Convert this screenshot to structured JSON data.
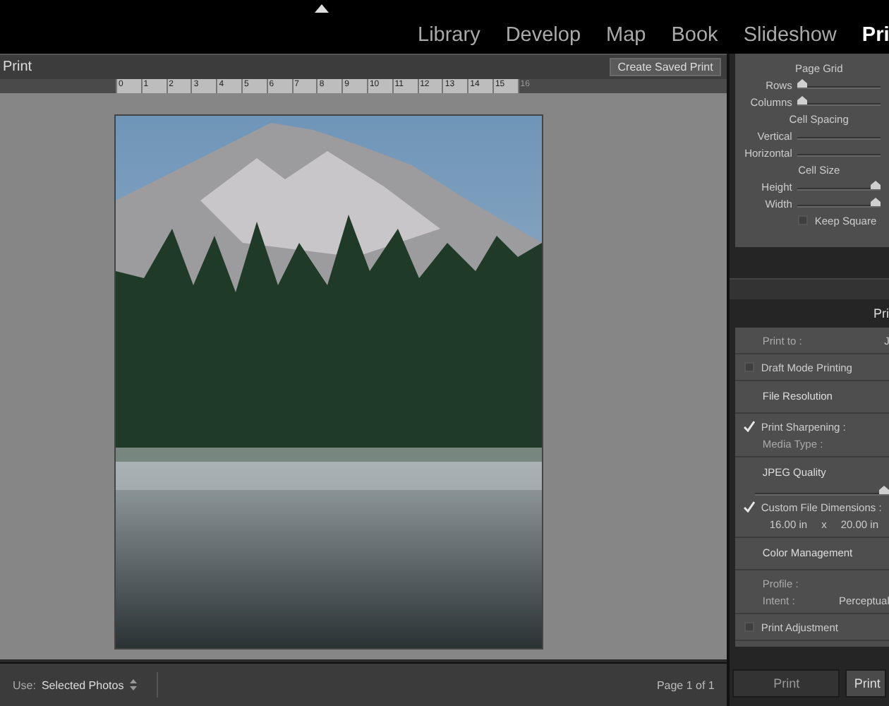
{
  "modules": [
    {
      "label": "Library",
      "selected": false
    },
    {
      "label": "Develop",
      "selected": false
    },
    {
      "label": "Map",
      "selected": false
    },
    {
      "label": "Book",
      "selected": false
    },
    {
      "label": "Slideshow",
      "selected": false
    },
    {
      "label": "Pri",
      "selected": true
    }
  ],
  "header": {
    "title": "Print",
    "button": "Create Saved Print"
  },
  "ruler": [
    "0",
    "1",
    "2",
    "3",
    "4",
    "5",
    "6",
    "7",
    "8",
    "9",
    "10",
    "11",
    "12",
    "13",
    "14",
    "15",
    "16"
  ],
  "toolbar": {
    "use_label": "Use:",
    "use_value": "Selected Photos",
    "page": "Page 1 of 1"
  },
  "page_grid": {
    "groups": [
      {
        "title": "Page Grid",
        "sliders": [
          {
            "kind": "slider",
            "label": "Rows",
            "level": 0
          },
          {
            "kind": "slider",
            "label": "Columns",
            "level": 0
          }
        ]
      },
      {
        "title": "Cell Spacing",
        "sliders": [
          {
            "kind": "track",
            "label": "Vertical"
          },
          {
            "kind": "track",
            "label": "Horizontal"
          }
        ]
      },
      {
        "title": "Cell Size",
        "sliders": [
          {
            "kind": "slider",
            "label": "Height",
            "level": 1
          },
          {
            "kind": "slider",
            "label": "Width",
            "level": 1
          }
        ]
      }
    ],
    "keep_square": {
      "label": "Keep Square",
      "checked": false
    }
  },
  "print_job": {
    "title": "Pri",
    "sections": [
      [
        {
          "kind": "field",
          "label": "Print to :",
          "value": "J"
        }
      ],
      [
        {
          "kind": "checkbox",
          "label": "Draft Mode Printing",
          "checked": false
        }
      ],
      [
        {
          "kind": "heading",
          "label": "File Resolution"
        }
      ],
      [
        {
          "kind": "checkbox",
          "label": "Print Sharpening :",
          "checked": true
        },
        {
          "kind": "field",
          "label": "Media Type :"
        }
      ],
      [
        {
          "kind": "heading",
          "label": "JPEG Quality"
        },
        {
          "kind": "slider",
          "level": 1
        },
        {
          "kind": "checkbox",
          "label": "Custom File Dimensions :",
          "checked": true
        },
        {
          "kind": "dims",
          "width": "16.00 in",
          "sep": "x",
          "height": "20.00 in"
        }
      ],
      [
        {
          "kind": "heading",
          "label": "Color Management"
        }
      ],
      [
        {
          "kind": "field",
          "label": "Profile :"
        },
        {
          "kind": "field",
          "label": "Intent :",
          "value": "Perceptual"
        }
      ],
      [
        {
          "kind": "checkbox",
          "label": "Print Adjustment",
          "checked": false
        }
      ]
    ]
  },
  "buttons": [
    "Print",
    "Print"
  ]
}
